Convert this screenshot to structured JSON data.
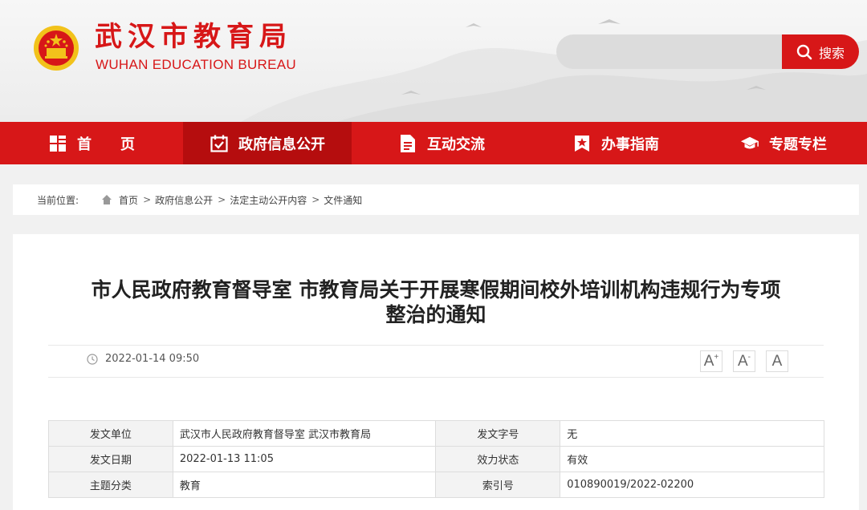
{
  "header": {
    "title_cn": "武汉市教育局",
    "title_en": "WUHAN EDUCATION BUREAU",
    "search": {
      "placeholder": "",
      "button_label": "搜索"
    }
  },
  "nav": {
    "items": [
      {
        "label": "首　　页",
        "icon": "grid-icon"
      },
      {
        "label": "政府信息公开",
        "icon": "calendar-check-icon",
        "active": true
      },
      {
        "label": "互动交流",
        "icon": "document-icon"
      },
      {
        "label": "办事指南",
        "icon": "bookmark-star-icon"
      },
      {
        "label": "专题专栏",
        "icon": "graduation-cap-icon"
      }
    ]
  },
  "breadcrumb": {
    "label": "当前位置:",
    "items": [
      "首页",
      "政府信息公开",
      "法定主动公开内容",
      "文件通知"
    ],
    "separator": ">"
  },
  "article": {
    "title_line1": "市人民政府教育督导室 市教育局关于开展寒假期间校外培训机构违规行为专项",
    "title_line2": "整治的通知",
    "datetime": "2022-01-14 09:50",
    "font_buttons": [
      "A",
      "A",
      "A"
    ]
  },
  "info": {
    "rows": [
      {
        "k1": "发文单位",
        "v1": "武汉市人民政府教育督导室 武汉市教育局",
        "k2": "发文字号",
        "v2": "无"
      },
      {
        "k1": "发文日期",
        "v1": "2022-01-13 11:05",
        "k2": "效力状态",
        "v2": "有效"
      },
      {
        "k1": "主题分类",
        "v1": "教育",
        "k2": "索引号",
        "v2": "010890019/2022-02200"
      }
    ]
  },
  "colors": {
    "brand_red": "#d71718",
    "nav_active": "#b50d0e",
    "emblem_gold": "#f2c21b"
  }
}
